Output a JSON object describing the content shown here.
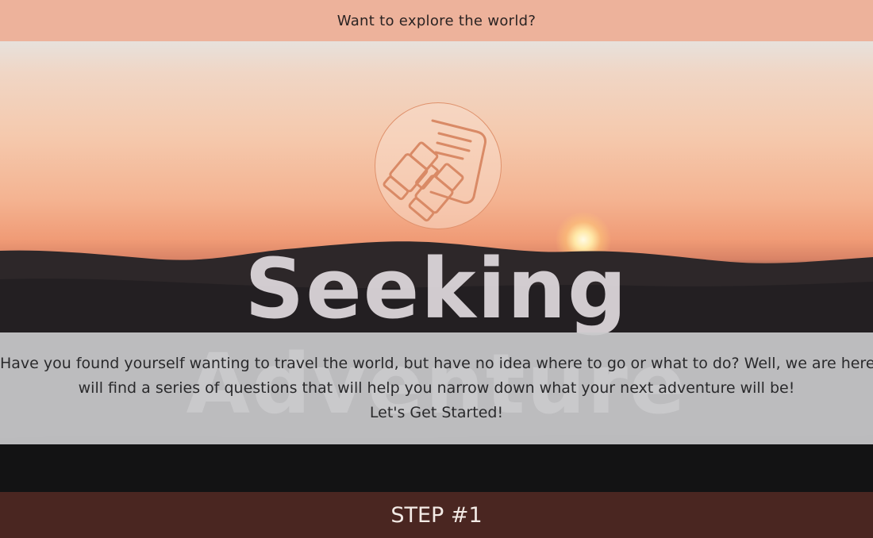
{
  "topbar": {
    "text": "Want to explore the world?"
  },
  "hero": {
    "title": "Seeking Adventure",
    "logo_icon": "binoculars-and-map-icon"
  },
  "intro": {
    "line1": "Have you found yourself wanting to travel the world, but have no idea where to go or what to do? Well, we are here to help! Below you",
    "line2": "will find a series of questions that will help you narrow down what your next adventure will be!",
    "line3": "Let's Get Started!"
  },
  "step": {
    "label": "STEP #1"
  },
  "colors": {
    "topbar_bg": "#edb29b",
    "step_bg": "#4a2621",
    "accent": "#df916c"
  }
}
